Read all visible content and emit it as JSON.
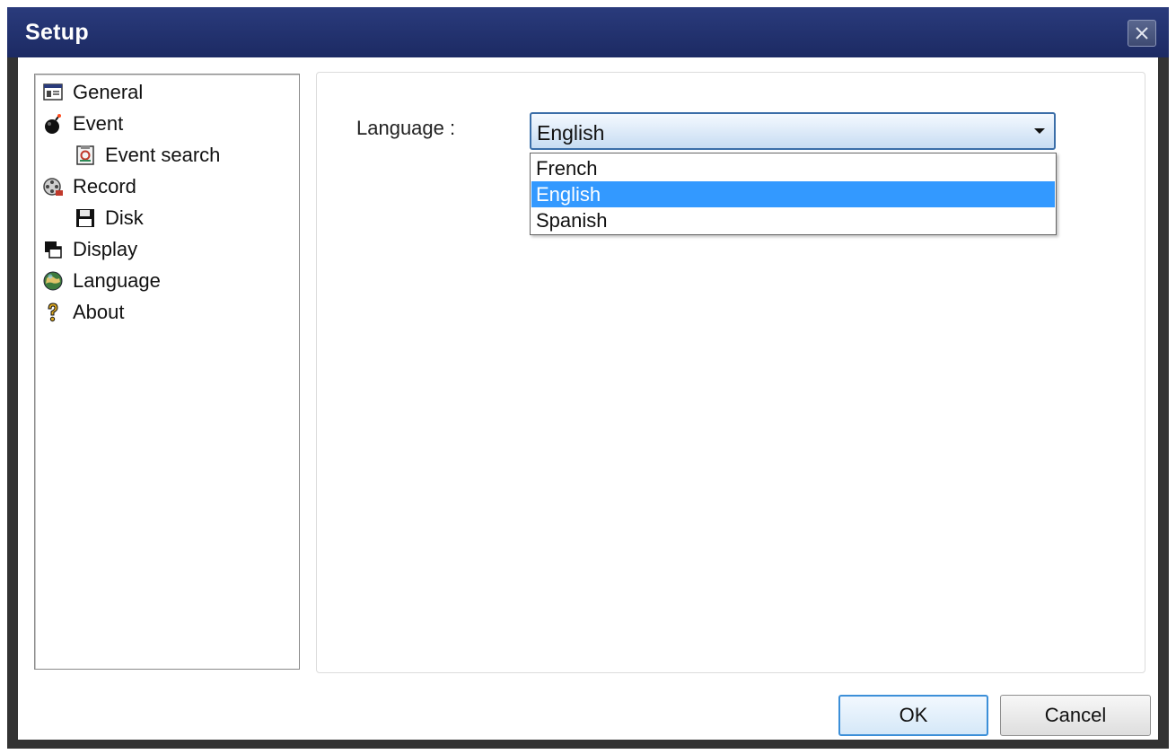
{
  "window": {
    "title": "Setup"
  },
  "tree": {
    "items": [
      {
        "label": "General",
        "icon": "general-settings-icon"
      },
      {
        "label": "Event",
        "icon": "bomb-icon"
      },
      {
        "label": "Event search",
        "icon": "event-search-icon"
      },
      {
        "label": "Record",
        "icon": "film-reel-icon"
      },
      {
        "label": "Disk",
        "icon": "floppy-disk-icon"
      },
      {
        "label": "Display",
        "icon": "display-windows-icon"
      },
      {
        "label": "Language",
        "icon": "globe-icon"
      },
      {
        "label": "About",
        "icon": "question-mark-icon"
      }
    ]
  },
  "language": {
    "label": "Language :",
    "selected": "English",
    "options": [
      "French",
      "English",
      "Spanish"
    ]
  },
  "buttons": {
    "ok": "OK",
    "cancel": "Cancel"
  },
  "colors": {
    "titlebar": "#1c2a63",
    "selection": "#3399ff",
    "ok_border": "#3c8fd8"
  }
}
